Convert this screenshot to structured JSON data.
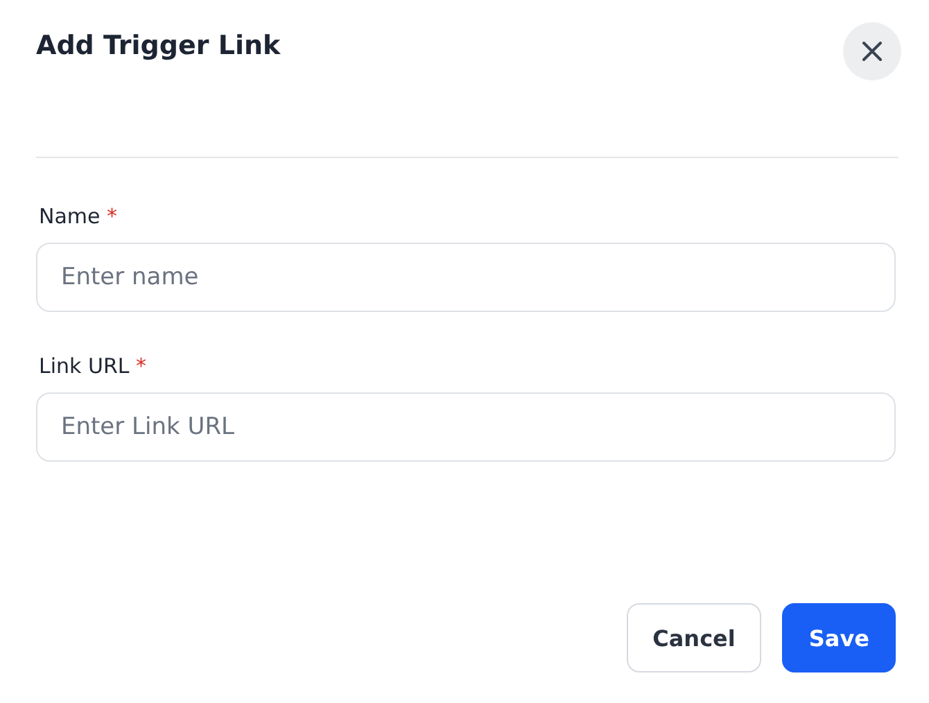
{
  "dialog": {
    "title": "Add Trigger Link"
  },
  "fields": [
    {
      "label": "Name",
      "required_mark": "*",
      "placeholder": "Enter name"
    },
    {
      "label": "Link URL",
      "required_mark": "*",
      "placeholder": "Enter Link URL"
    }
  ],
  "buttons": [
    {
      "label": "Cancel",
      "kind": "secondary"
    },
    {
      "label": "Save",
      "kind": "primary"
    }
  ]
}
